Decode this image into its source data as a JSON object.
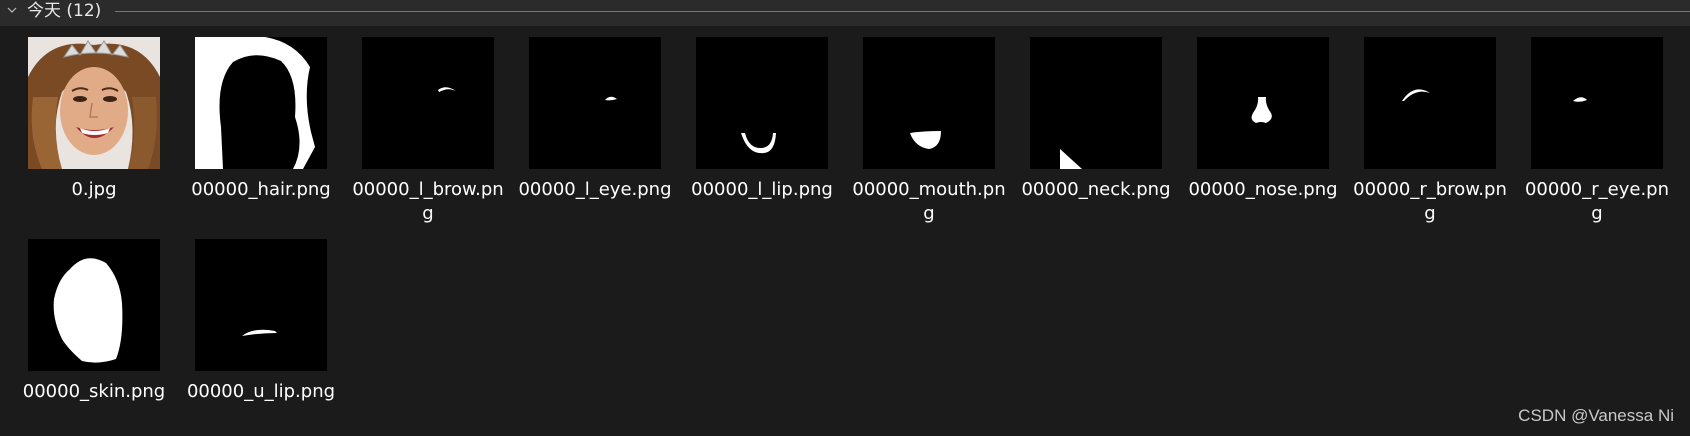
{
  "group": {
    "title": "今天 (12)"
  },
  "files": [
    {
      "name": "0.jpg",
      "thumb": "face-photo"
    },
    {
      "name": "00000_hair.png",
      "thumb": "hair-mask"
    },
    {
      "name": "00000_l_brow.png",
      "thumb": "l-brow-mask"
    },
    {
      "name": "00000_l_eye.png",
      "thumb": "l-eye-mask"
    },
    {
      "name": "00000_l_lip.png",
      "thumb": "l-lip-mask"
    },
    {
      "name": "00000_mouth.png",
      "thumb": "mouth-mask"
    },
    {
      "name": "00000_neck.png",
      "thumb": "neck-mask"
    },
    {
      "name": "00000_nose.png",
      "thumb": "nose-mask"
    },
    {
      "name": "00000_r_brow.png",
      "thumb": "r-brow-mask"
    },
    {
      "name": "00000_r_eye.png",
      "thumb": "r-eye-mask"
    },
    {
      "name": "00000_skin.png",
      "thumb": "skin-mask"
    },
    {
      "name": "00000_u_lip.png",
      "thumb": "u-lip-mask"
    }
  ],
  "watermark": "CSDN @Vanessa Ni",
  "colors": {
    "background": "#1b1b1b",
    "header": "#2b2b2b",
    "mask_fg": "#ffffff",
    "mask_bg": "#000000"
  }
}
